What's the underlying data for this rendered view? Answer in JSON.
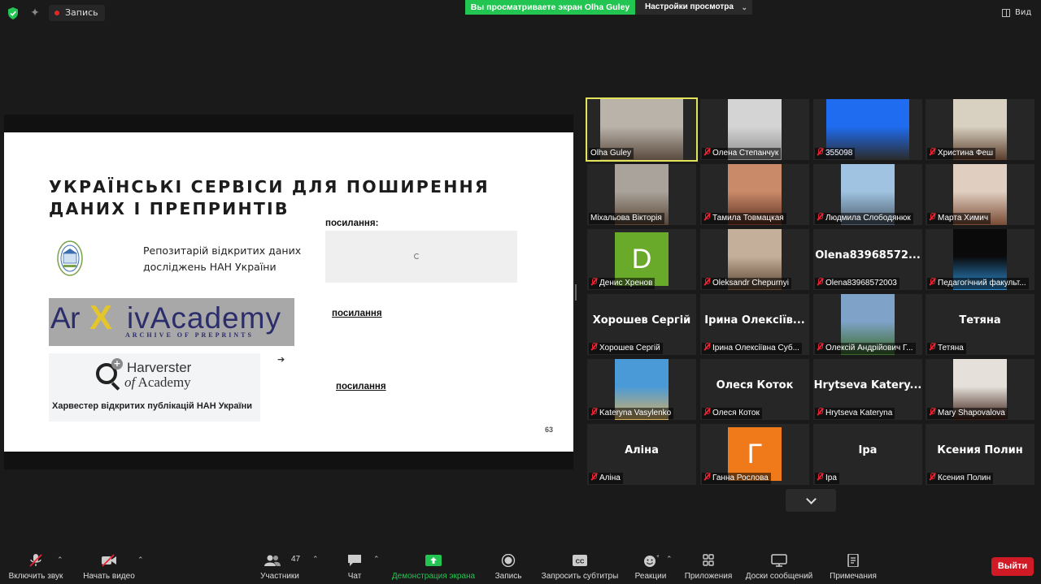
{
  "topbar": {
    "record_label": "Запись",
    "share_banner": "Вы просматриваете экран Olha Guley",
    "view_settings": "Настройки просмотра",
    "view_label": "Вид"
  },
  "slide": {
    "title_line1": "УКРАЇНСЬКІ СЕРВІСИ ДЛЯ ПОШИРЕННЯ",
    "title_line2": "ДАНИХ І ПРЕПРИНТІВ",
    "link_header": "посилання:",
    "repo_line1": "Репозитарій відкритих даних",
    "repo_line2": "досліджень НАН України",
    "arxiv_left": "Ar",
    "arxiv_x": "X",
    "arxiv_right": "ivAcademy",
    "arxiv_sub": "ARCHIVE OF PREPRINTS",
    "link1": "посилання",
    "harvester_line1": "Harverster",
    "harvester_of": "of",
    "harvester_academy": "Academy",
    "harvester_caption": "Харвестер відкритих публікацій НАН України",
    "arrow": "➔",
    "link2": "посилання",
    "page_number": "63"
  },
  "participants": [
    {
      "name": "Olha Guley",
      "big": "",
      "kind": "video",
      "active": true,
      "muted": false
    },
    {
      "name": "Олена Степанчук",
      "big": "",
      "kind": "video",
      "muted": true
    },
    {
      "name": "355098",
      "big": "",
      "kind": "video",
      "muted": true
    },
    {
      "name": "Христина Феш",
      "big": "",
      "kind": "video",
      "muted": true
    },
    {
      "name": "Міхальова Вікторія",
      "big": "",
      "kind": "video",
      "muted": false
    },
    {
      "name": "Тамила Товмацкая",
      "big": "",
      "kind": "video",
      "muted": true
    },
    {
      "name": "Людмила Слободянюк",
      "big": "",
      "kind": "video",
      "muted": true
    },
    {
      "name": "Марта Химич",
      "big": "",
      "kind": "video",
      "muted": true
    },
    {
      "name": "Денис Хренов",
      "big": "",
      "kind": "avatar",
      "avatar_letter": "D",
      "avatar_color": "#6aaa2b",
      "muted": true
    },
    {
      "name": "Oleksandr Chepurnyi",
      "big": "",
      "kind": "video",
      "muted": true
    },
    {
      "name": "Olena83968572003",
      "big": "Olena83968572...",
      "kind": "name",
      "muted": true
    },
    {
      "name": "Педагогічний факульт...",
      "big": "",
      "kind": "video",
      "muted": true
    },
    {
      "name": "Хорошев Сергій",
      "big": "Хорошев Сергій",
      "kind": "name",
      "muted": true
    },
    {
      "name": "Ірина Олексіївна Суб...",
      "big": "Ірина Олексіїв...",
      "kind": "name",
      "muted": true
    },
    {
      "name": "Олексій Андрійович Г...",
      "big": "",
      "kind": "video",
      "muted": true
    },
    {
      "name": "Тетяна",
      "big": "Тетяна",
      "kind": "name",
      "muted": true
    },
    {
      "name": "Kateryna Vasylenko",
      "big": "",
      "kind": "video",
      "muted": true
    },
    {
      "name": "Олеся Коток",
      "big": "Олеся Коток",
      "kind": "name",
      "muted": true
    },
    {
      "name": "Hrytseva Kateryna",
      "big": "Hrytseva Katery...",
      "kind": "name",
      "muted": true
    },
    {
      "name": "Mary Shapovalova",
      "big": "",
      "kind": "video",
      "muted": true
    },
    {
      "name": "Аліна",
      "big": "Аліна",
      "kind": "name",
      "muted": true
    },
    {
      "name": "Ганна Рослова",
      "big": "",
      "kind": "avatar",
      "avatar_letter": "Г",
      "avatar_color": "#f07a1a",
      "muted": true
    },
    {
      "name": "Іра",
      "big": "Іра",
      "kind": "name",
      "muted": true
    },
    {
      "name": "Ксения Полин",
      "big": "Ксения Полин",
      "kind": "name",
      "muted": true
    }
  ],
  "toolbar": {
    "unmute": "Включить звук",
    "start_video": "Начать видео",
    "participants": "Участники",
    "participants_count": "47",
    "chat": "Чат",
    "share_screen": "Демонстрация экрана",
    "record": "Запись",
    "captions": "Запросить субтитры",
    "reactions": "Реакции",
    "apps": "Приложения",
    "whiteboards": "Доски сообщений",
    "notes": "Примечания",
    "leave": "Выйти"
  },
  "colors": {
    "share_green": "#23c552",
    "leave_red": "#d01a26",
    "active_speaker": "#e2e35b",
    "background": "#1a1a1a"
  }
}
